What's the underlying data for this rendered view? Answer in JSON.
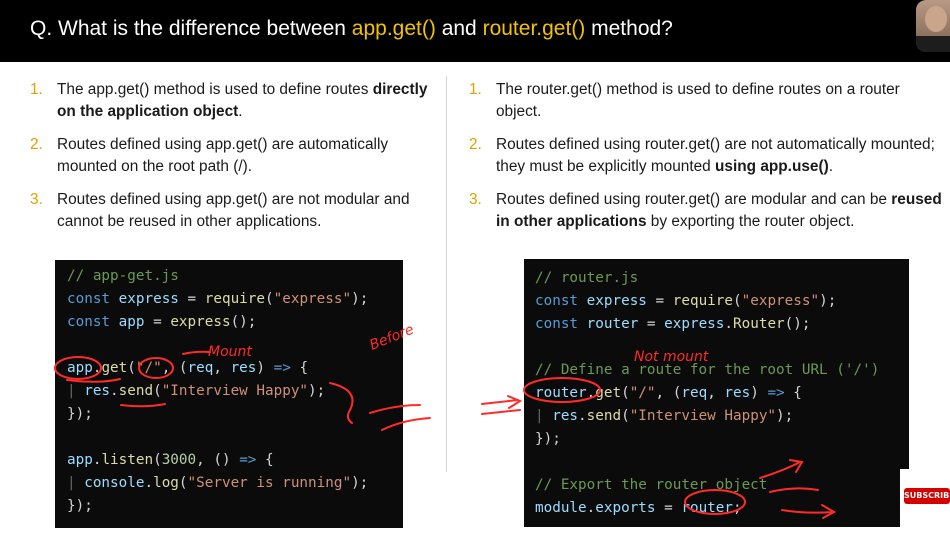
{
  "header": {
    "q_prefix": "Q. What is the difference between ",
    "q_hl1": "app.get()",
    "q_mid": " and ",
    "q_hl2": "router.get()",
    "q_suffix": " method?"
  },
  "left_points": [
    {
      "num": "1.",
      "text": "The app.get() method is used to define routes ",
      "bold": "directly on the application object",
      "tail": "."
    },
    {
      "num": "2.",
      "text": "Routes defined using app.get() are automatically mounted on the root path (/).",
      "bold": "",
      "tail": ""
    },
    {
      "num": "3.",
      "text": "Routes defined using app.get() are not modular and cannot be reused in other applications.",
      "bold": "",
      "tail": ""
    }
  ],
  "right_points": [
    {
      "num": "1.",
      "text": "The router.get() method is used to define routes on a router object.",
      "bold": "",
      "tail": ""
    },
    {
      "num": "2.",
      "text": "Routes defined using router.get() are not automatically mounted; they must be explicitly mounted ",
      "bold": "using app.use()",
      "tail": "."
    },
    {
      "num": "3.",
      "text": "Routes defined using router.get() are modular and can be ",
      "bold": "reused in other applications",
      "tail": " by exporting the router object."
    }
  ],
  "code_left": {
    "l1": "// app-get.js",
    "l2_kw": "const",
    "l2_id": "express",
    "l2_fn": "require",
    "l2_st": "\"express\"",
    "l3_kw": "const",
    "l3_id": "app",
    "l3_fn": "express",
    "l5_id": "app",
    "l5_fn": "get",
    "l5_st": "\"/\"",
    "l5_p1": "req",
    "l5_p2": "res",
    "l6_id": "res",
    "l6_fn": "send",
    "l6_st": "\"Interview Happy\"",
    "l9_id": "app",
    "l9_fn": "listen",
    "l9_nu": "3000",
    "l10_id": "console",
    "l10_fn": "log",
    "l10_st": "\"Server is running\""
  },
  "code_right": {
    "l1": "// router.js",
    "l2_kw": "const",
    "l2_id": "express",
    "l2_fn": "require",
    "l2_st": "\"express\"",
    "l3_kw": "const",
    "l3_id": "router",
    "l3_id2": "express",
    "l3_fn": "Router",
    "l5": "// Define a route for the root URL ('/')",
    "l6_id": "router",
    "l6_fn": "get",
    "l6_st": "\"/\"",
    "l6_p1": "req",
    "l6_p2": "res",
    "l7_id": "res",
    "l7_fn": "send",
    "l7_st": "\"Interview Happy\"",
    "l10": "// Export the router object",
    "l11_id": "module",
    "l11_id2": "exports",
    "l11_id3": "router"
  },
  "annotations": {
    "mount": "Mount",
    "before": "Before",
    "not_mount": "Not mount"
  },
  "subscribe": "SUBSCRIBE",
  "colors": {
    "header_bg": "#000000",
    "highlight": "#f2c200",
    "number": "#e0a100",
    "ink": "#ff2a2a"
  }
}
